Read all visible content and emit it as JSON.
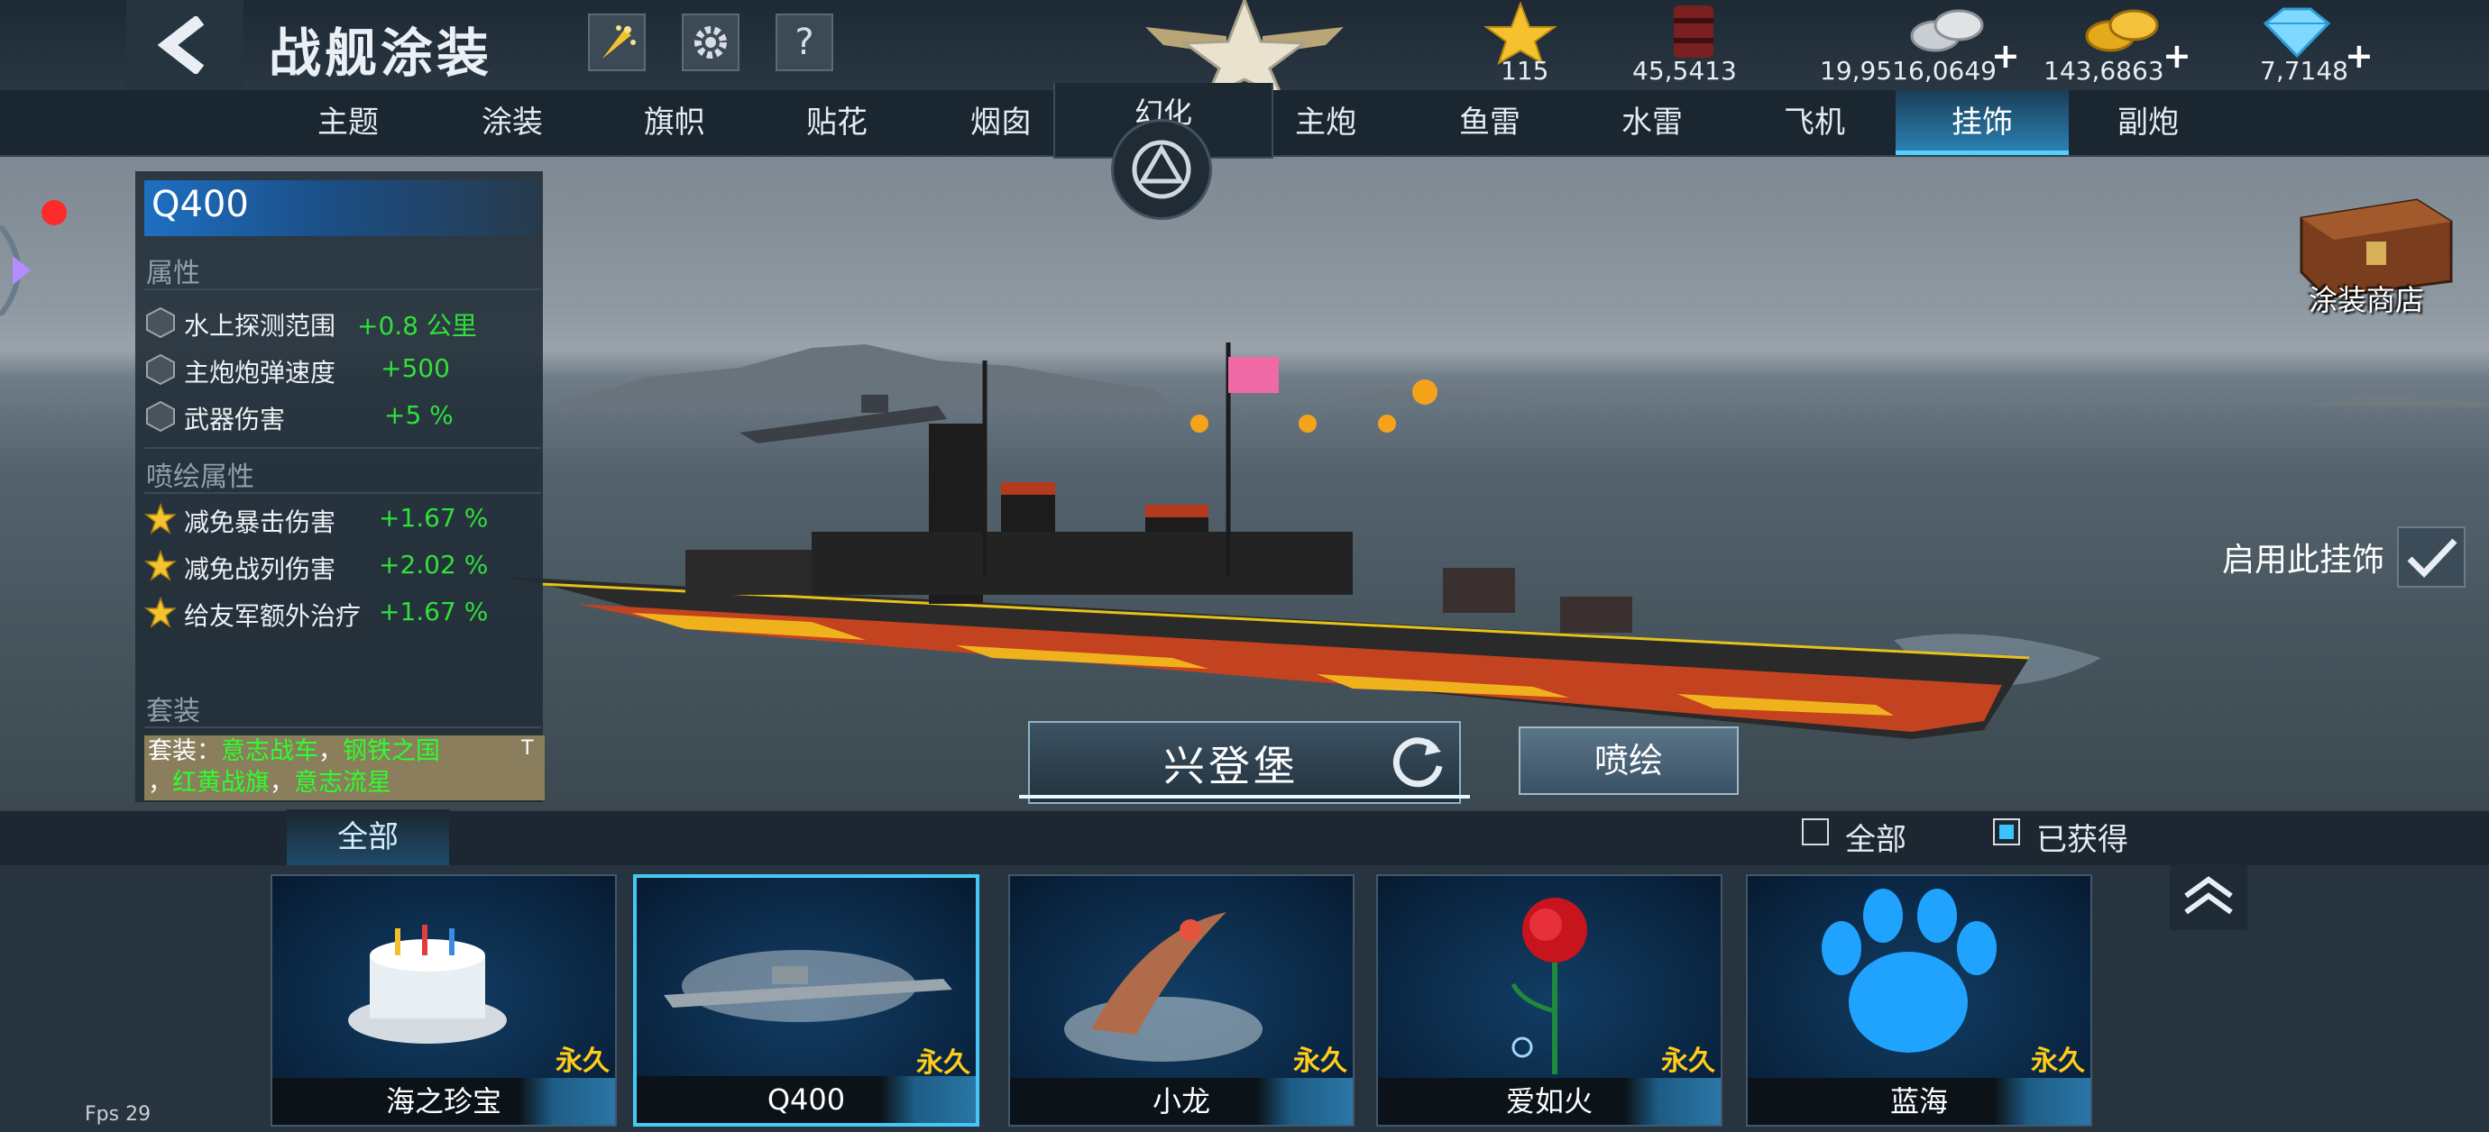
{
  "header": {
    "title": "战舰涂装",
    "help_label": "?",
    "resources": [
      {
        "name": "star-medal",
        "value": "115",
        "has_plus": false
      },
      {
        "name": "oil-barrel",
        "value": "45,5413",
        "has_plus": false
      },
      {
        "name": "silver-coins",
        "value": "19,9516,0649",
        "has_plus": true
      },
      {
        "name": "gold-coins",
        "value": "143,6863",
        "has_plus": true
      },
      {
        "name": "diamonds",
        "value": "7,7148",
        "has_plus": true
      }
    ],
    "plus_label": "+"
  },
  "tabs": {
    "t1": "主题",
    "t2": "涂装",
    "t3": "旗帜",
    "t4": "贴花",
    "t5": "烟囱",
    "center": "幻化",
    "t6": "主炮",
    "t7": "鱼雷",
    "t8": "水雷",
    "t9": "飞机",
    "t10": "挂饰",
    "t11": "副炮",
    "active": "挂饰"
  },
  "panel": {
    "item_name": "Q400",
    "attr_header": "属性",
    "attrs": [
      {
        "label": "水上探测范围",
        "value": "+0.8 公里"
      },
      {
        "label": "主炮炮弹速度",
        "value": "+500"
      },
      {
        "label": "武器伤害",
        "value": "+5 %"
      }
    ],
    "paint_header": "喷绘属性",
    "paint_attrs": [
      {
        "label": "减免暴击伤害",
        "value": "+1.67 %"
      },
      {
        "label": "减免战列伤害",
        "value": "+2.02 %"
      },
      {
        "label": "给友军额外治疗",
        "value": "+1.67 %"
      }
    ],
    "set_header": "套装",
    "set_prefix": "套装：",
    "set_items": [
      "意志战车",
      "钢铁之国",
      "红黄战旗",
      "意志流星"
    ],
    "set_tag": "T"
  },
  "scene": {
    "ship_name": "兴登堡",
    "paint_button": "喷绘",
    "enable_label": "启用此挂饰",
    "enable_checked": true,
    "shop_label": "涂装商店"
  },
  "filter": {
    "tab_label": "全部",
    "cb_all_label": "全部",
    "cb_all_checked": false,
    "cb_owned_label": "已获得",
    "cb_owned_checked": true
  },
  "items": [
    {
      "name": "海之珍宝",
      "tag": "永久",
      "icon": "birthday-cake"
    },
    {
      "name": "Q400",
      "tag": "永久",
      "icon": "submarine",
      "selected": true
    },
    {
      "name": "小龙",
      "tag": "永久",
      "icon": "dragon-splash"
    },
    {
      "name": "爱如火",
      "tag": "永久",
      "icon": "red-rose"
    },
    {
      "name": "蓝海",
      "tag": "永久",
      "icon": "blue-paw"
    }
  ],
  "debug": {
    "fps": "Fps 29"
  }
}
